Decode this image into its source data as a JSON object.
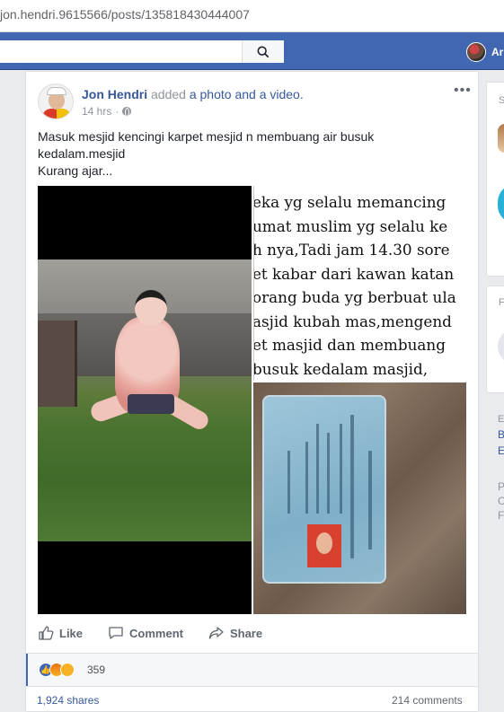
{
  "browser": {
    "url": "jon.hendri.9615566/posts/135818430444007"
  },
  "header": {
    "profile_name_partial": "Ar"
  },
  "post": {
    "author": "Jon Hendri",
    "action_prefix": "added",
    "action_link": "a photo and a video.",
    "time": "14 hrs",
    "time_separator": "·",
    "more_menu": "•••",
    "text_line1": "Masuk mesjid kencingi karpet mesjid n membuang air busuk",
    "text_line2": "kedalam.mesjid",
    "text_line3": "Kurang ajar...",
    "overlay_lines": [
      "eka yg selalu memancing",
      "umat muslim yg selalu ke",
      "h nya,Tadi jam 14.30 sore",
      "et kabar dari kawan katan",
      "orang buda yg berbuat ula",
      "asjid kubah mas,mengend",
      "et masjid dan membuang",
      "busuk kedalam masjid,"
    ],
    "actions": {
      "like": "Like",
      "comment": "Comment",
      "share": "Share"
    },
    "reactions": {
      "count": "359",
      "types": [
        "like",
        "angry",
        "wow"
      ]
    },
    "shares": "1,924 shares",
    "comments": "214 comments"
  },
  "right_column": {
    "box1_letter": "S",
    "box2_letter": "F",
    "e_letter": "E",
    "links": [
      "B",
      "E"
    ],
    "gray_letters": [
      "P",
      "C",
      "F"
    ]
  }
}
